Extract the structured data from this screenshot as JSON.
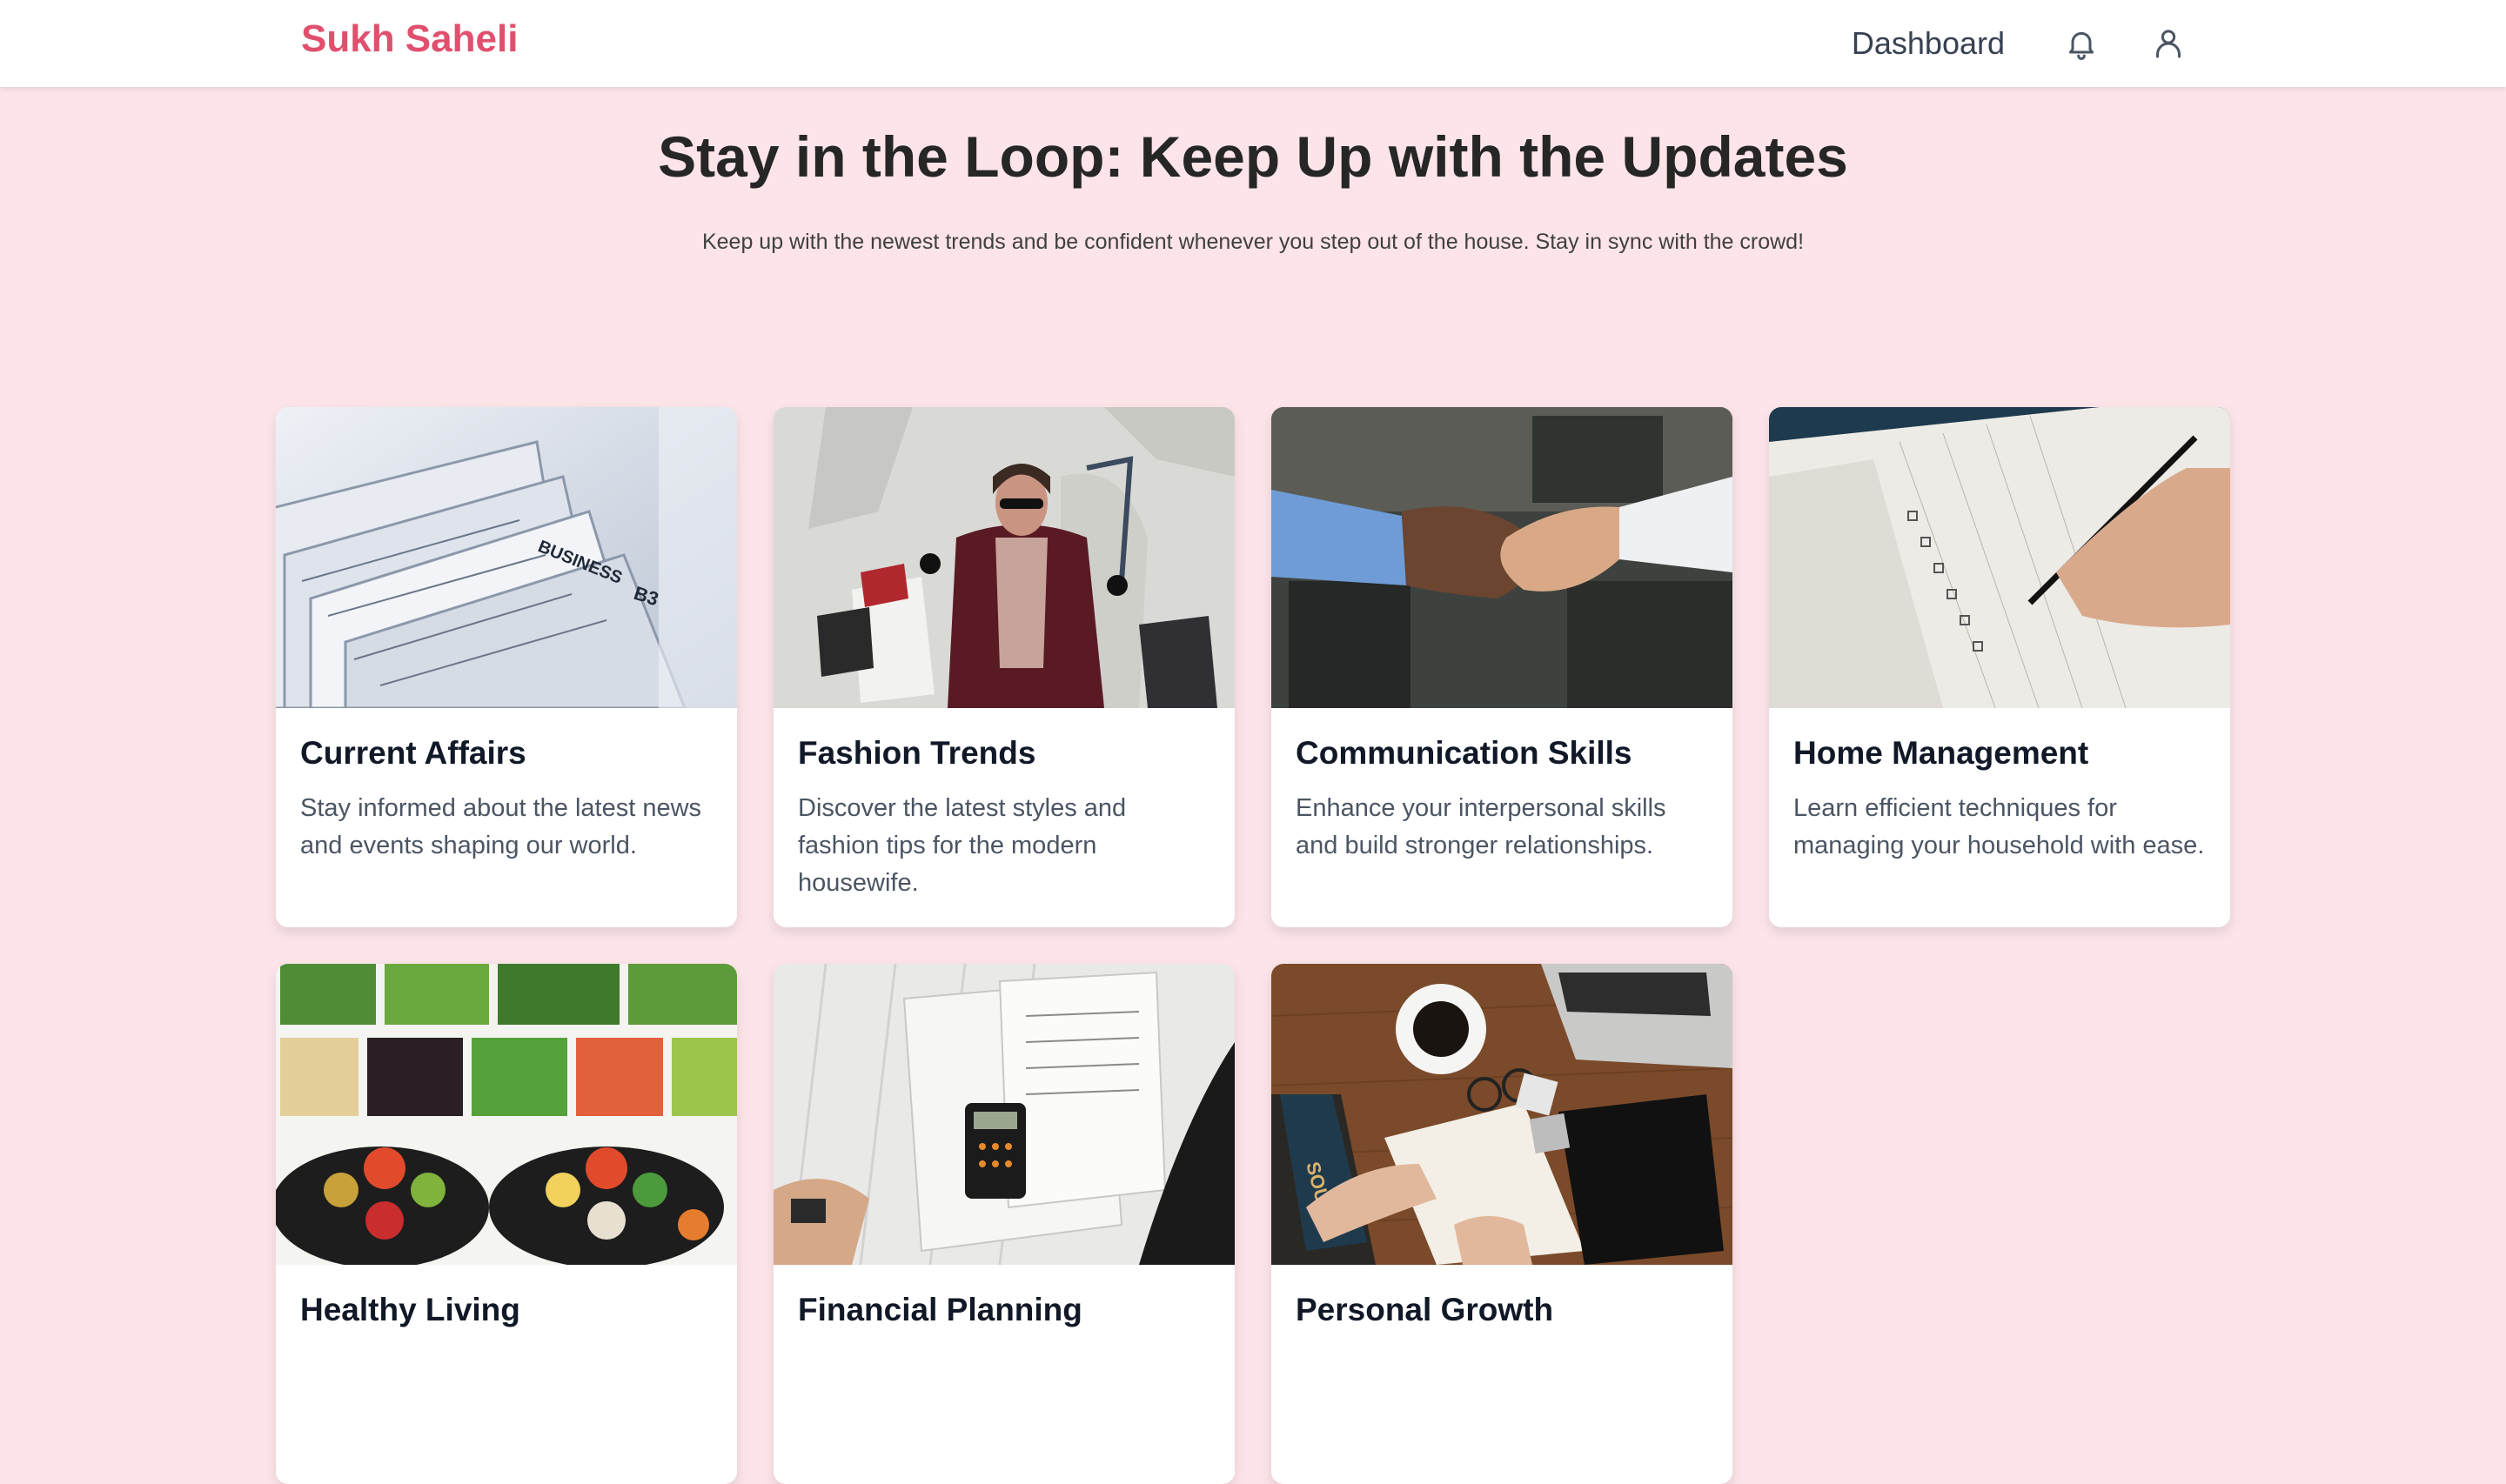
{
  "nav": {
    "brand": "Sukh Saheli",
    "dashboard_label": "Dashboard",
    "brand_color": "#e0506e",
    "icons": [
      "bell-icon",
      "user-icon"
    ]
  },
  "hero": {
    "title": "Stay in the Loop: Keep Up with the Updates",
    "subtitle": "Keep up with the newest trends and be confident whenever you step out of the house. Stay in sync with the crowd!"
  },
  "cards": [
    {
      "title": "Current Affairs",
      "description": "Stay informed about the latest news and events shaping our world.",
      "image": "newspapers-photo"
    },
    {
      "title": "Fashion Trends",
      "description": "Discover the latest styles and fashion tips for the modern housewife.",
      "image": "shopping-woman-photo"
    },
    {
      "title": "Communication Skills",
      "description": "Enhance your interpersonal skills and build stronger relationships.",
      "image": "handshake-photo"
    },
    {
      "title": "Home Management",
      "description": "Learn efficient techniques for managing your household with ease.",
      "image": "notebook-checklist-photo"
    },
    {
      "title": "Healthy Living",
      "description": "",
      "image": "vegetables-photo"
    },
    {
      "title": "Financial Planning",
      "description": "",
      "image": "documents-calculator-photo"
    },
    {
      "title": "Personal Growth",
      "description": "",
      "image": "desk-journal-photo"
    }
  ],
  "image_text": {
    "newspaper_masthead": "BUSINESS",
    "newspaper_page": "B3",
    "book_spine": "SOUL"
  },
  "colors": {
    "page_background": "#fce4e8",
    "card_background": "#ffffff"
  }
}
